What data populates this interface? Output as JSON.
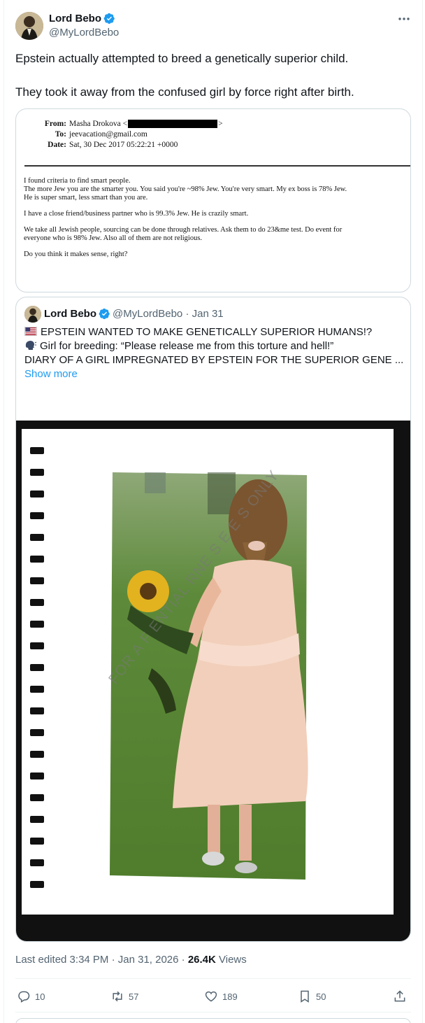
{
  "author": {
    "name": "Lord Bebo",
    "handle": "@MyLordBebo"
  },
  "tweet": {
    "paragraphs": [
      "Epstein actually attempted to breed a genetically superior child.",
      "They took it away from the confused girl by force right after birth."
    ]
  },
  "email_image": {
    "from_label": "From:",
    "from_value": "Masha Drokova <",
    "from_suffix": ">",
    "to_label": "To:",
    "to_value": "jeevacation@gmail.com",
    "date_label": "Date:",
    "date_value": "Sat, 30 Dec 2017 05:22:21 +0000",
    "body": [
      "I found criteria to find smart people.\nThe more Jew you are the smarter you. You said you're ~98% Jew. You're very smart. My ex boss is 78% Jew.\nHe is super smart, less smart than you are.",
      "I have a close friend/business partner who is 99.3% Jew. He is crazily smart.",
      "We take all Jewish people, sourcing can be done through relatives. Ask them to do 23&me test. Do event for\neveryone who is 98% Jew. Also all of them are not religious.",
      "Do you think it makes sense, right?"
    ]
  },
  "quoted": {
    "name": "Lord Bebo",
    "handle_date": "@MyLordBebo · Jan 31",
    "line1": "EPSTEIN WANTED TO MAKE GENETICALLY SUPERIOR HUMANS!?",
    "line2": "Girl for breeding: “Please release me from this torture and hell!”",
    "line3": "DIARY OF A GIRL IMPREGNATED BY EPSTEIN FOR THE SUPERIOR GENE ...",
    "show_more": "Show more",
    "watermark": "FOR A   F   ENTIAL    RNE  S E E S ONLY"
  },
  "meta": {
    "edited": "Last edited 3:34 PM · Jan 31, 2026 · ",
    "views_count": "26.4K",
    "views_label": " Views"
  },
  "actions": {
    "replies": "10",
    "reposts": "57",
    "likes": "189",
    "bookmarks": "50"
  },
  "colors": {
    "accent": "#1d9bf0",
    "text": "#0f1419",
    "secondary": "#536471",
    "border": "#cfd9de"
  },
  "icons": [
    "more-icon",
    "verified-badge-icon",
    "us-flag-icon",
    "speaking-head-icon",
    "reply-icon",
    "repost-icon",
    "like-icon",
    "bookmark-icon",
    "share-icon"
  ]
}
